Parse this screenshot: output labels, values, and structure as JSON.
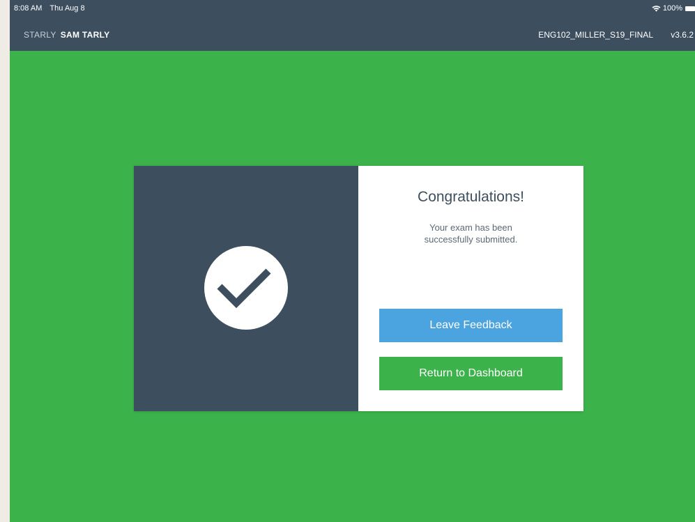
{
  "status_bar": {
    "time": "8:08 AM",
    "date": "Thu Aug 8",
    "battery": "100%"
  },
  "header": {
    "brand": "STARLY",
    "user": "SAM TARLY",
    "exam_code": "ENG102_MILLER_S19_FINAL",
    "version": "v3.6.2"
  },
  "dialog": {
    "title": "Congratulations!",
    "message_line1": "Your exam has been",
    "message_line2": "successfully submitted.",
    "feedback_label": "Leave Feedback",
    "dashboard_label": "Return to Dashboard"
  },
  "icons": {
    "status": "checkmark-icon",
    "wifi": "wifi-icon",
    "battery": "battery-icon"
  },
  "colors": {
    "background": "#3cb24b",
    "header": "#3d4e5f",
    "feedback_button": "#4ba3e0",
    "dashboard_button": "#3cb24b"
  }
}
